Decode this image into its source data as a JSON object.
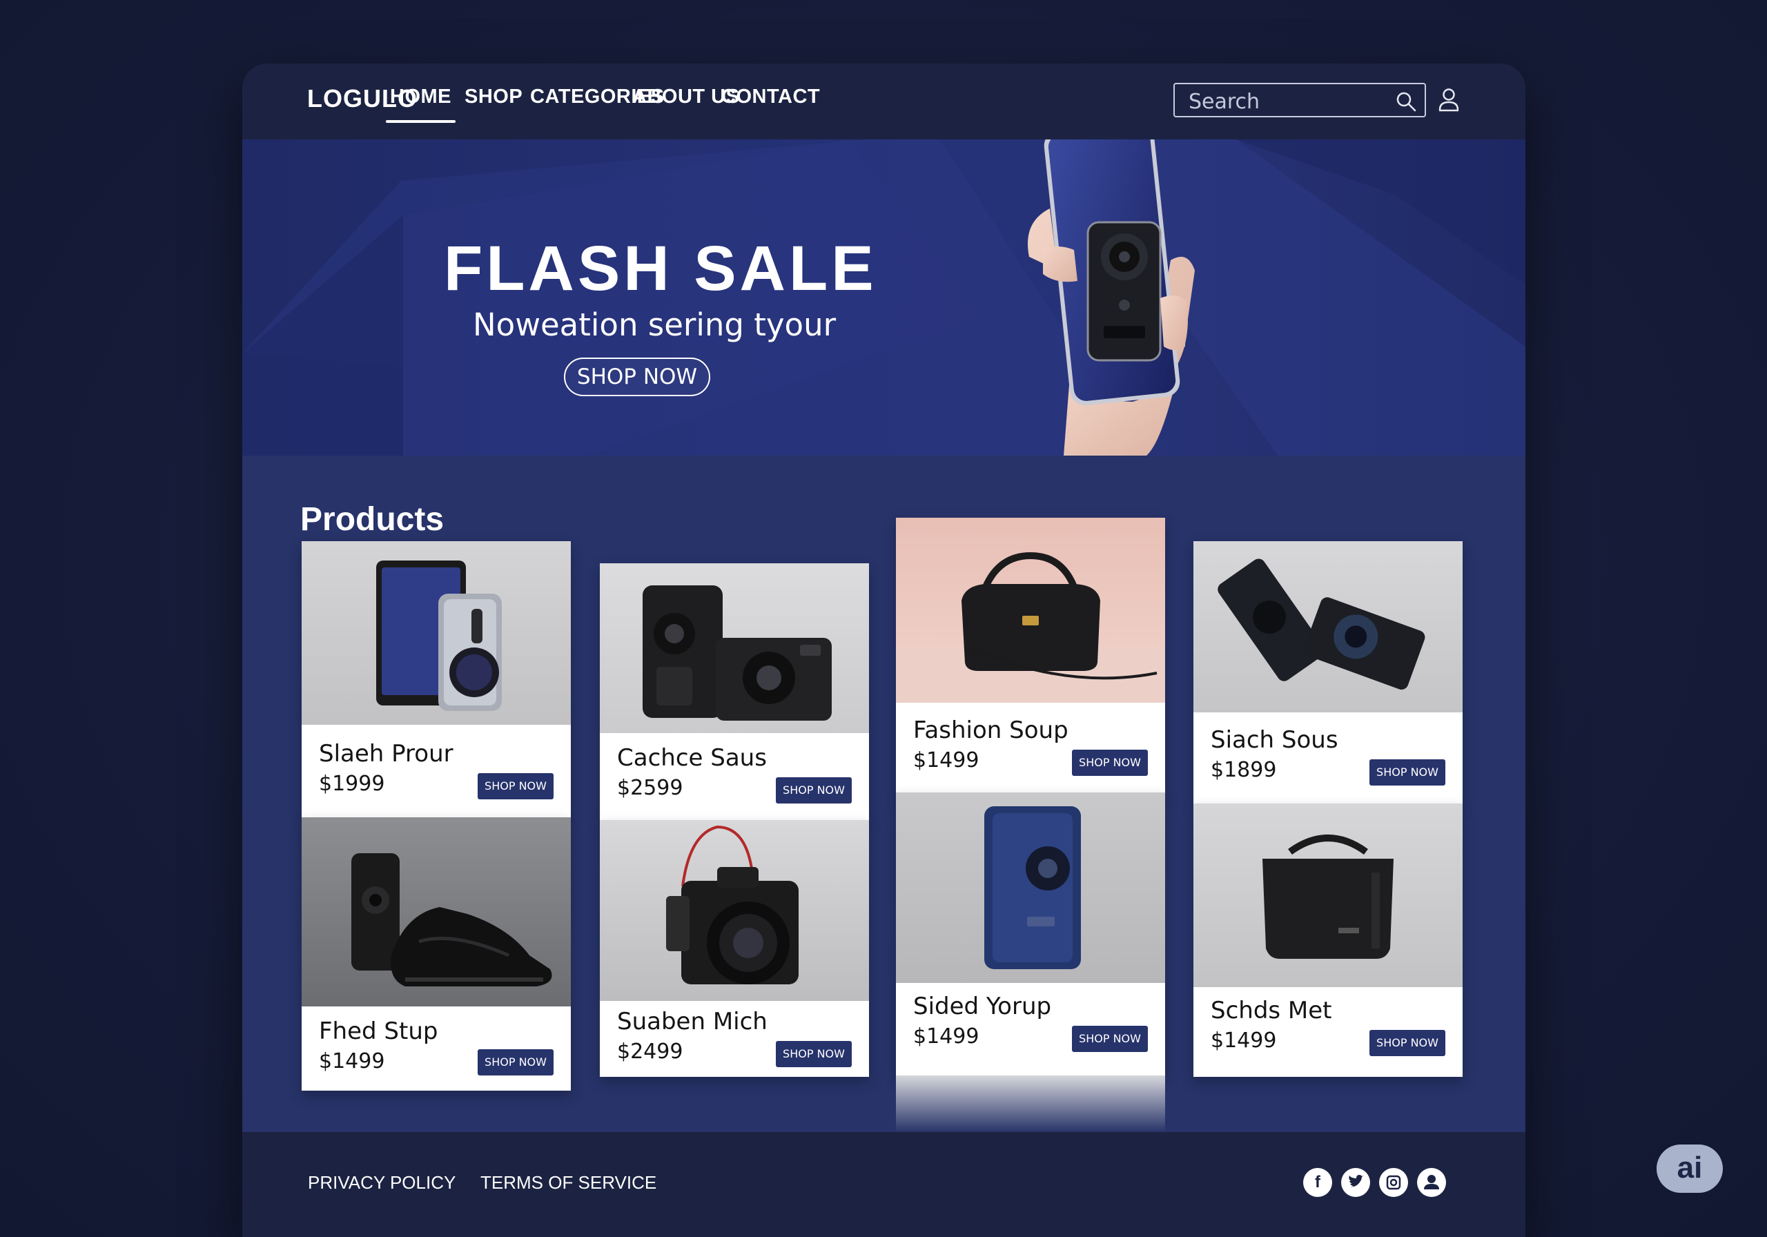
{
  "nav": {
    "logo": "LOGULO",
    "links": [
      "HOME",
      "SHOP",
      "CATEGORIES",
      "ABOUT US",
      "CONTACT"
    ],
    "active": "HOME",
    "search_placeholder": "Search"
  },
  "hero": {
    "title": "FLASH SALE",
    "subtitle": "Noweation sering tyour",
    "button": "SHOP NOW"
  },
  "products": {
    "title": "Products",
    "items": [
      {
        "name": "Slaeh Prour",
        "price": "$1999",
        "button": "SHOP NOW",
        "image": "phone-speaker"
      },
      {
        "name": "Cachce Saus",
        "price": "$2599",
        "button": "SHOP NOW",
        "image": "cameras"
      },
      {
        "name": "Fashion Soup",
        "price": "$1499",
        "button": "SHOP NOW",
        "image": "handbag"
      },
      {
        "name": "Siach Sous",
        "price": "$1899",
        "button": "SHOP NOW",
        "image": "camera-devices"
      },
      {
        "name": "Fhed Stup",
        "price": "$1499",
        "button": "SHOP NOW",
        "image": "speaker-sneakers"
      },
      {
        "name": "Suaben Mich",
        "price": "$2499",
        "button": "SHOP NOW",
        "image": "dslr-camera"
      },
      {
        "name": "Sided Yorup",
        "price": "$1499",
        "button": "SHOP NOW",
        "image": "blue-speaker"
      },
      {
        "name": "Schds Met",
        "price": "$1499",
        "button": "SHOP NOW",
        "image": "black-bag"
      }
    ]
  },
  "footer": {
    "links": [
      "PRIVACY POLICY",
      "TERMS OF SERVICE"
    ],
    "social_icons": [
      "facebook-icon",
      "twitter-icon",
      "instagram-icon",
      "account-icon"
    ]
  },
  "badge": "ai",
  "colors": {
    "navy_bg": "#1a2040",
    "products_bg": "#273369",
    "button": "#27336b"
  }
}
